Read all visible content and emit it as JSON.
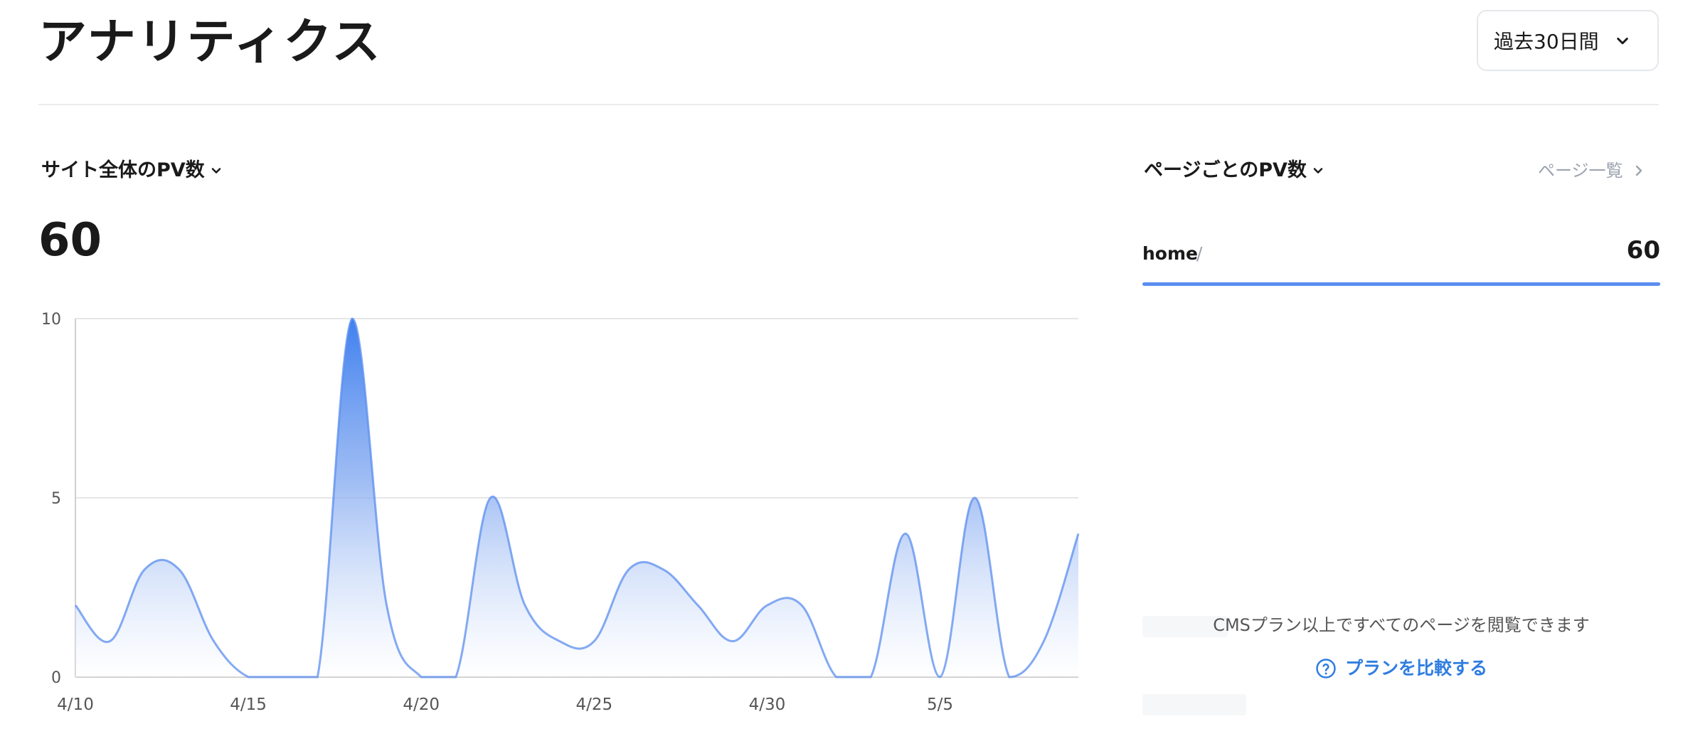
{
  "header": {
    "title": "アナリティクス",
    "range_select": {
      "value": "過去30日間"
    }
  },
  "site_total": {
    "title": "サイト全体のPV数",
    "total": "60"
  },
  "chart_data": {
    "type": "area",
    "x": [
      "4/10",
      "4/11",
      "4/12",
      "4/13",
      "4/14",
      "4/15",
      "4/16",
      "4/17",
      "4/18",
      "4/19",
      "4/20",
      "4/21",
      "4/22",
      "4/23",
      "4/24",
      "4/25",
      "4/26",
      "4/27",
      "4/28",
      "4/29",
      "4/30",
      "5/1",
      "5/2",
      "5/3",
      "5/4",
      "5/5",
      "5/6",
      "5/7",
      "5/8",
      "5/9"
    ],
    "values": [
      2,
      1,
      3,
      3,
      1,
      0,
      0,
      0,
      10,
      2,
      0,
      0,
      5,
      2,
      1,
      1,
      3,
      3,
      2,
      1,
      2,
      2,
      0,
      0,
      4,
      0,
      5,
      0,
      1,
      4
    ],
    "x_tick_labels": [
      "4/10",
      "4/15",
      "4/20",
      "4/25",
      "4/30",
      "5/5"
    ],
    "y_tick_labels": [
      "0",
      "5",
      "10"
    ],
    "ylim": [
      0,
      10
    ],
    "grid": true,
    "title": "",
    "xlabel": "",
    "ylabel": "",
    "colors": {
      "line": "#5b8def",
      "fill_top": "#3f80ef",
      "fill_bottom": "#ffffff"
    }
  },
  "per_page": {
    "title": "ページごとのPV数",
    "list_link": "ページ一覧",
    "rows": [
      {
        "name": "home",
        "path": "/",
        "value": "60",
        "share": 1.0
      }
    ],
    "upsell_text": "CMSプラン以上ですべてのページを閲覧できます",
    "compare_link": "プランを比較する"
  },
  "colors": {
    "accent": "#2f7de1",
    "bar": "#5b8def"
  }
}
